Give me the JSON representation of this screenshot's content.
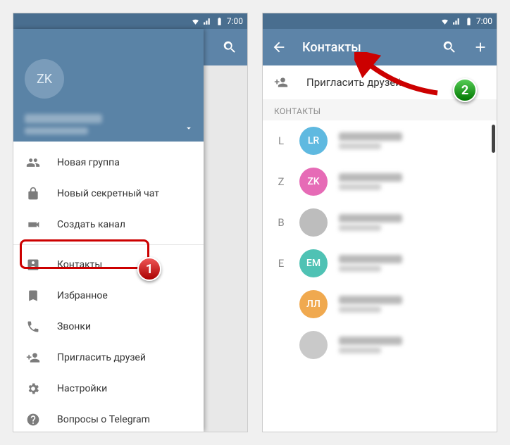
{
  "status": {
    "time": "7:00"
  },
  "drawer": {
    "avatar_initials": "ZK",
    "items": [
      {
        "label": "Новая группа"
      },
      {
        "label": "Новый секретный чат"
      },
      {
        "label": "Создать канал"
      },
      {
        "label": "Контакты"
      },
      {
        "label": "Избранное"
      },
      {
        "label": "Звонки"
      },
      {
        "label": "Пригласить друзей"
      },
      {
        "label": "Настройки"
      },
      {
        "label": "Вопросы о Telegram"
      }
    ]
  },
  "contacts": {
    "title": "Контакты",
    "invite_label": "Пригласить друзей",
    "section_label": "КОНТАКТЫ",
    "rows": [
      {
        "letter": "L",
        "initials": "LR",
        "color": "#5fb9e0"
      },
      {
        "letter": "Z",
        "initials": "ZK",
        "color": "#e66bb6"
      },
      {
        "letter": "B",
        "initials": "",
        "color": "#bdbdbd"
      },
      {
        "letter": "E",
        "initials": "EM",
        "color": "#4fc2b4"
      },
      {
        "letter": "",
        "initials": "ЛЛ",
        "color": "#f0a94f"
      },
      {
        "letter": "",
        "initials": "",
        "color": "#c9c9c9"
      }
    ]
  },
  "callouts": {
    "one": "1",
    "two": "2"
  }
}
